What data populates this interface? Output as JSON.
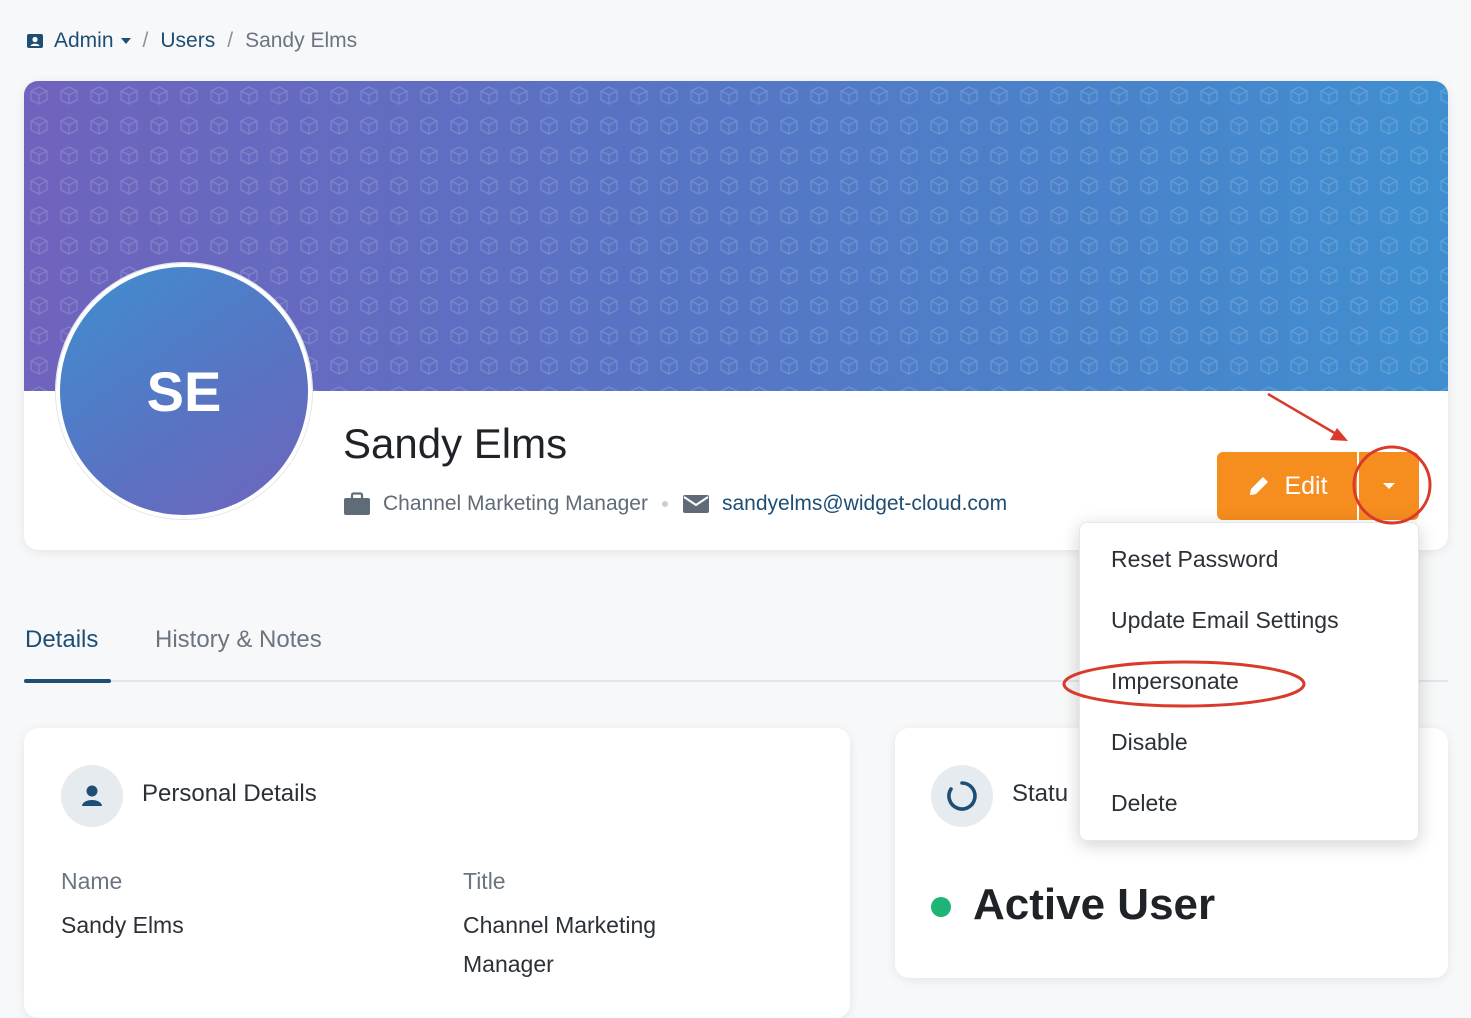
{
  "breadcrumb": {
    "admin": "Admin",
    "users": "Users",
    "current": "Sandy Elms"
  },
  "profile": {
    "initials": "SE",
    "name": "Sandy Elms",
    "title": "Channel Marketing Manager",
    "email": "sandyelms@widget-cloud.com"
  },
  "actions": {
    "edit_label": "Edit"
  },
  "dropdown": {
    "items": [
      "Reset Password",
      "Update Email Settings",
      "Impersonate",
      "Disable",
      "Delete"
    ]
  },
  "tabs": [
    {
      "label": "Details",
      "active": true
    },
    {
      "label": "History & Notes",
      "active": false
    }
  ],
  "personal": {
    "heading": "Personal Details",
    "name_label": "Name",
    "name_value": "Sandy Elms",
    "title_label": "Title",
    "title_value_line1": "Channel Marketing",
    "title_value_line2": "Manager"
  },
  "status": {
    "heading_visible": "Statu",
    "state": "Active User"
  },
  "colors": {
    "accent": "#f68d1f",
    "primary": "#1f4e75",
    "active": "#1db575",
    "annotation": "#d93a2b"
  },
  "icons": [
    "user-badge-icon",
    "briefcase-icon",
    "envelope-icon",
    "pencil-icon",
    "person-icon",
    "status-ring-icon"
  ]
}
